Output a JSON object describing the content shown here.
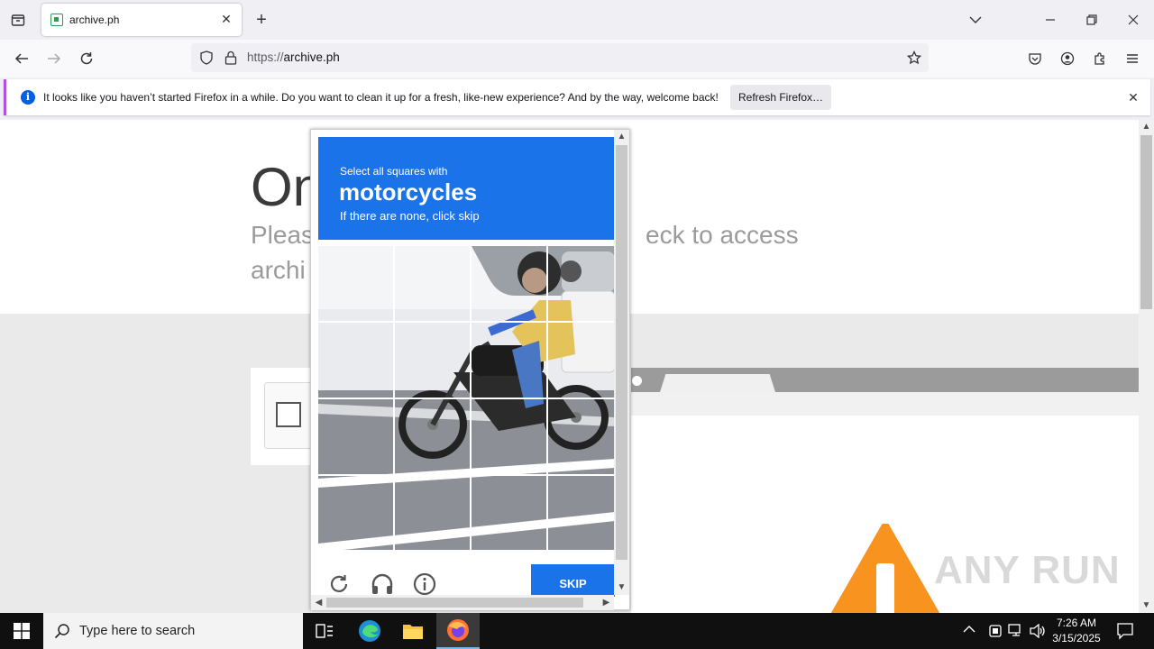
{
  "browser": {
    "tab_title": "archive.ph",
    "url_scheme": "https://",
    "url_host": "archive.ph",
    "new_tab_symbol": "+",
    "notification": {
      "message": "It looks like you haven’t started Firefox in a while. Do you want to clean it up for a fresh, like-new experience? And by the way, welcome back!",
      "button_label": "Refresh Firefox…"
    }
  },
  "page": {
    "heading": "On",
    "subtext_line1": "Pleas",
    "subtext_line1_right": "eck to access",
    "subtext_line2": "archi"
  },
  "captcha": {
    "instruction_small": "Select all squares with",
    "target": "motorcycles",
    "hint": "If there are none, click skip",
    "skip_label": "SKIP",
    "grid_rows": 4,
    "grid_cols": 4
  },
  "taskbar": {
    "search_placeholder": "Type here to search",
    "time": "7:26 AM",
    "date": "3/15/2025"
  },
  "watermark": "ANY RUN",
  "colors": {
    "captcha_blue": "#1a73e8",
    "notification_accent": "#b14fe0",
    "warning_orange": "#f7931e"
  }
}
